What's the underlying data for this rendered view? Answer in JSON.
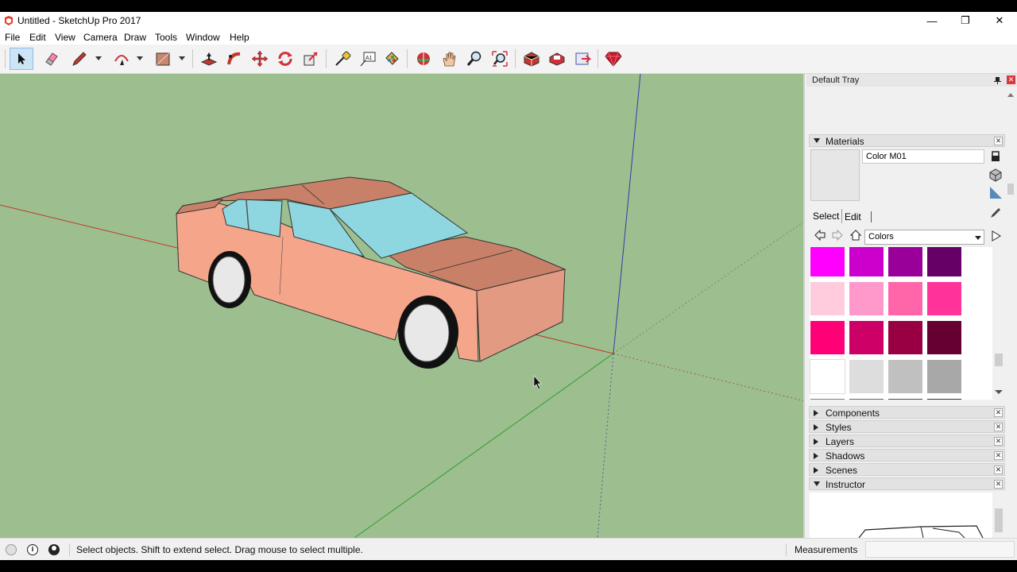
{
  "window": {
    "title": "Untitled - SketchUp Pro 2017",
    "minimize": "—",
    "restore": "❐",
    "close": "✕"
  },
  "menu": [
    "File",
    "Edit",
    "View",
    "Camera",
    "Draw",
    "Tools",
    "Window",
    "Help"
  ],
  "toolbar": {
    "tools": [
      "select-tool",
      "eraser-tool",
      "line-tool",
      "arc-tool",
      "rectangle-tool",
      "push-pull-tool",
      "follow-me-tool",
      "move-tool",
      "rotate-tool",
      "scale-tool",
      "tape-measure-tool",
      "text-tool",
      "paint-bucket-tool",
      "orbit-tool",
      "pan-tool",
      "zoom-tool",
      "zoom-extents-tool",
      "3d-warehouse-tool",
      "extension-warehouse-tool",
      "layout-tool",
      "ruby-console-tool"
    ]
  },
  "tray": {
    "title": "Default Tray",
    "materials": {
      "title": "Materials",
      "name_value": "Color M01",
      "tab_select": "Select",
      "tab_edit": "Edit",
      "library": "Colors",
      "swatches": [
        [
          "#ff00ff",
          "#cc00cc",
          "#990099",
          "#660066"
        ],
        [
          "#ffccdd",
          "#ff99cc",
          "#ff66aa",
          "#ff3399"
        ],
        [
          "#ff0077",
          "#cc0066",
          "#990044",
          "#660033"
        ],
        [
          "#ffffff",
          "#dddddd",
          "#c0c0c0",
          "#a8a8a8"
        ],
        [
          "#808080",
          "#666666",
          "#4d4d4d",
          "#333333"
        ]
      ]
    },
    "panels": [
      "Components",
      "Styles",
      "Layers",
      "Shadows",
      "Scenes"
    ],
    "instructor": "Instructor"
  },
  "status": {
    "message": "Select objects. Shift to extend select. Drag mouse to select multiple.",
    "measurements_label": "Measurements",
    "measurements_value": ""
  },
  "colors": {
    "viewport_bg": "#9dbf8f",
    "car_body": "#f4a58a",
    "car_roof": "#c98068",
    "glass": "#8ed7e0",
    "axis_red": "#c0392b",
    "axis_green": "#2e9e2e",
    "axis_blue": "#2a3fa8"
  }
}
